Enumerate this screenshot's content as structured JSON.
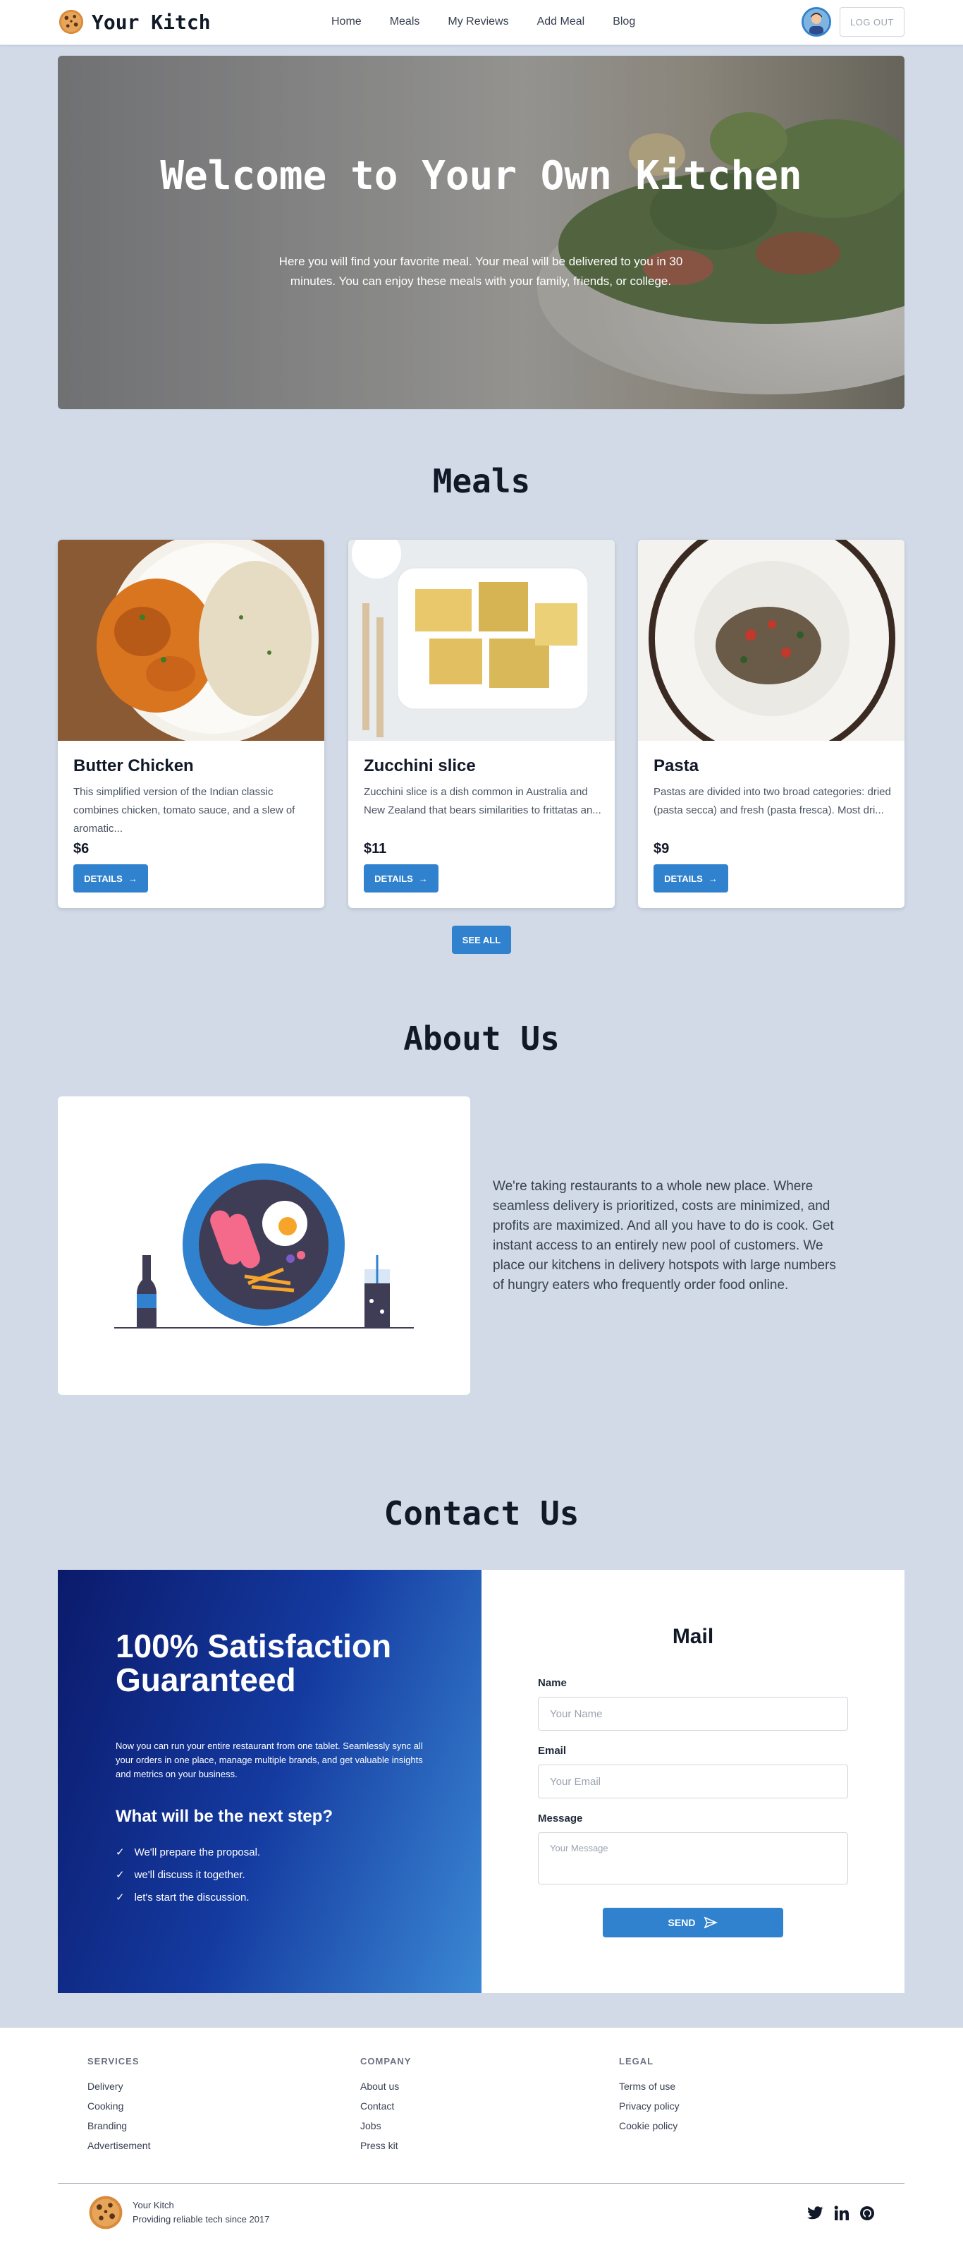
{
  "nav": {
    "brand": "Your Kitch",
    "links": [
      "Home",
      "Meals",
      "My Reviews",
      "Add Meal",
      "Blog"
    ],
    "logout": "LOG OUT"
  },
  "hero": {
    "title": "Welcome to Your Own Kitchen",
    "subtitle": "Here you will find your favorite meal. Your meal will be delivered to you in 30 minutes. You can enjoy these meals with your family, friends, or college."
  },
  "meals": {
    "title": "Meals",
    "cards": [
      {
        "name": "Butter Chicken",
        "description": "This simplified version of the Indian classic combines chicken, tomato sauce, and a slew of aromatic...",
        "price": "$6",
        "button": "DETAILS"
      },
      {
        "name": "Zucchini slice",
        "description": "Zucchini slice is a dish common in Australia and New Zealand that bears similarities to frittatas an...",
        "price": "$11",
        "button": "DETAILS"
      },
      {
        "name": "Pasta",
        "description": "Pastas are divided into two broad categories: dried (pasta secca) and fresh (pasta fresca). Most dri...",
        "price": "$9",
        "button": "DETAILS"
      }
    ],
    "see_all": "SEE ALL"
  },
  "about": {
    "title": "About Us",
    "text": "We're taking restaurants to a whole new place. Where seamless delivery is prioritized, costs are minimized, and profits are maximized. And all you have to do is cook. Get instant access to an entirely new pool of customers. We place our kitchens in delivery hotspots with large numbers of hungry eaters who frequently order food online."
  },
  "contact": {
    "title": "Contact Us",
    "headline": "100% Satisfaction Guaranteed",
    "paragraph": "Now you can run your entire restaurant from one tablet. Seamlessly sync all your orders in one place, manage multiple brands, and get valuable insights and metrics on your business.",
    "next_step": "What will be the next step?",
    "steps": [
      "We'll prepare the proposal.",
      "we'll discuss it together.",
      "let's start the discussion."
    ],
    "form": {
      "title": "Mail",
      "name_label": "Name",
      "name_placeholder": "Your Name",
      "email_label": "Email",
      "email_placeholder": "Your Email",
      "message_label": "Message",
      "message_placeholder": "Your Message",
      "send": "SEND"
    }
  },
  "footer": {
    "services": {
      "heading": "SERVICES",
      "items": [
        "Delivery",
        "Cooking",
        "Branding",
        "Advertisement"
      ]
    },
    "company": {
      "heading": "COMPANY",
      "items": [
        "About us",
        "Contact",
        "Jobs",
        "Press kit"
      ]
    },
    "legal": {
      "heading": "LEGAL",
      "items": [
        "Terms of use",
        "Privacy policy",
        "Cookie policy"
      ]
    },
    "brand": "Your Kitch",
    "tagline": "Providing reliable tech since 2017"
  }
}
